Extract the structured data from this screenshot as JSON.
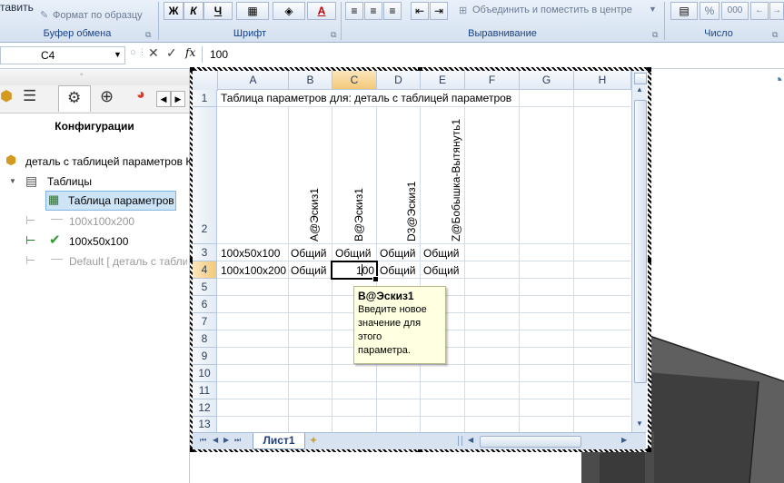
{
  "ribbon": {
    "paste_label": "тавить",
    "format_painter_label": "Формат по образцу",
    "clipboard_group": "Буфер обмена",
    "bold": "Ж",
    "italic": "К",
    "underline": "Ч",
    "font_color_letter": "А",
    "font_group": "Шрифт",
    "merge_label": "Объединить и поместить в центре",
    "alignment_group": "Выравнивание",
    "percent": "%",
    "thousands": "000",
    "number_group": "Число"
  },
  "formula_bar": {
    "name_box": "C4",
    "fx": "fx",
    "value": "100"
  },
  "left_panel": {
    "title": "Конфигурации",
    "tree": {
      "root": "деталь с таблицей параметров К",
      "tables": "Таблицы",
      "param_table": "Таблица параметров",
      "config1": "100x100x200",
      "config2": "100x50x100",
      "config3": "Default [ деталь с таблиц"
    }
  },
  "sheet": {
    "columns": [
      "A",
      "B",
      "C",
      "D",
      "E",
      "F",
      "G",
      "H"
    ],
    "rows": [
      "1",
      "2",
      "3",
      "4",
      "5",
      "6",
      "7",
      "8",
      "9",
      "10",
      "11",
      "12",
      "13"
    ],
    "a1": "Таблица параметров для: деталь с таблицей параметров",
    "headers_row2": [
      "A@Эскиз1",
      "B@Эскиз1",
      "D3@Эскиз1",
      "Z@Бобышка-Вытянуть1"
    ],
    "row3": [
      "100x50x100",
      "Общий",
      "Общий",
      "Общий",
      "Общий"
    ],
    "row4": [
      "100x100x200",
      "Общий",
      "100",
      "Общий",
      "Общий"
    ],
    "tab": "Лист1"
  },
  "tooltip": {
    "title": "B@Эскиз1",
    "body": [
      "Введите новое",
      "значение для",
      "этого",
      "параметра."
    ]
  },
  "colors": {
    "ribbon_bg": "#dfe8f4",
    "ribbon_label": "#15428b",
    "header_bg": "#e3ebf5",
    "selected_header": "#f8d9a0",
    "tooltip_bg": "#ffffe1",
    "tab_text": "#1f3f7a",
    "check_green": "#2e9b2e"
  }
}
